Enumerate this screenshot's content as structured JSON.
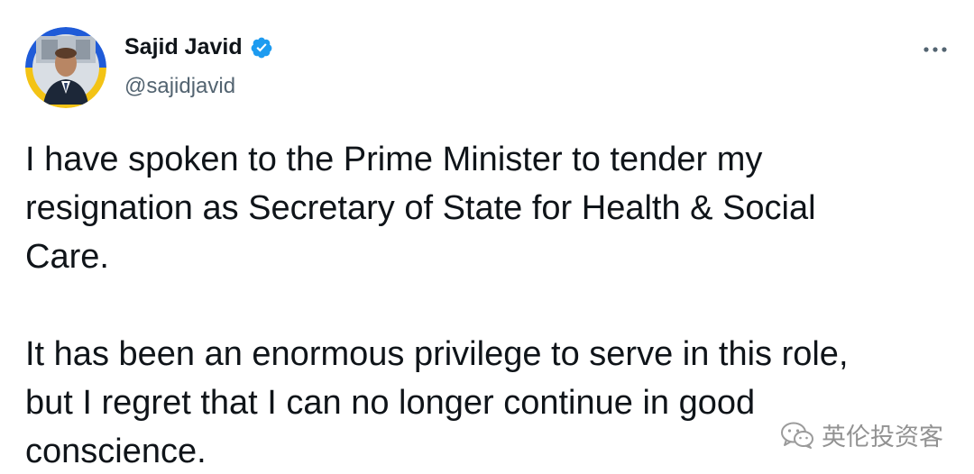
{
  "author": {
    "display_name": "Sajid Javid",
    "handle": "@sajidjavid",
    "verified": true,
    "avatar_icon": "profile-photo-avatar",
    "avatar_ring_colors": [
      "#1f5bd8",
      "#f3c315"
    ]
  },
  "tweet": {
    "paragraphs": [
      "I have spoken to the Prime Minister to tender my\nresignation as Secretary of State for Health & Social\nCare.",
      "It has been an enormous privilege to serve in this role,\nbut I regret that I can no longer continue in good\nconscience."
    ]
  },
  "menu": {
    "icon": "more-options-icon"
  },
  "watermark": {
    "text": "英伦投资客",
    "icon": "wechat-logo"
  },
  "colors": {
    "verified": "#1d9bf0",
    "primary_text": "#0f1419",
    "secondary_text": "#536471"
  }
}
